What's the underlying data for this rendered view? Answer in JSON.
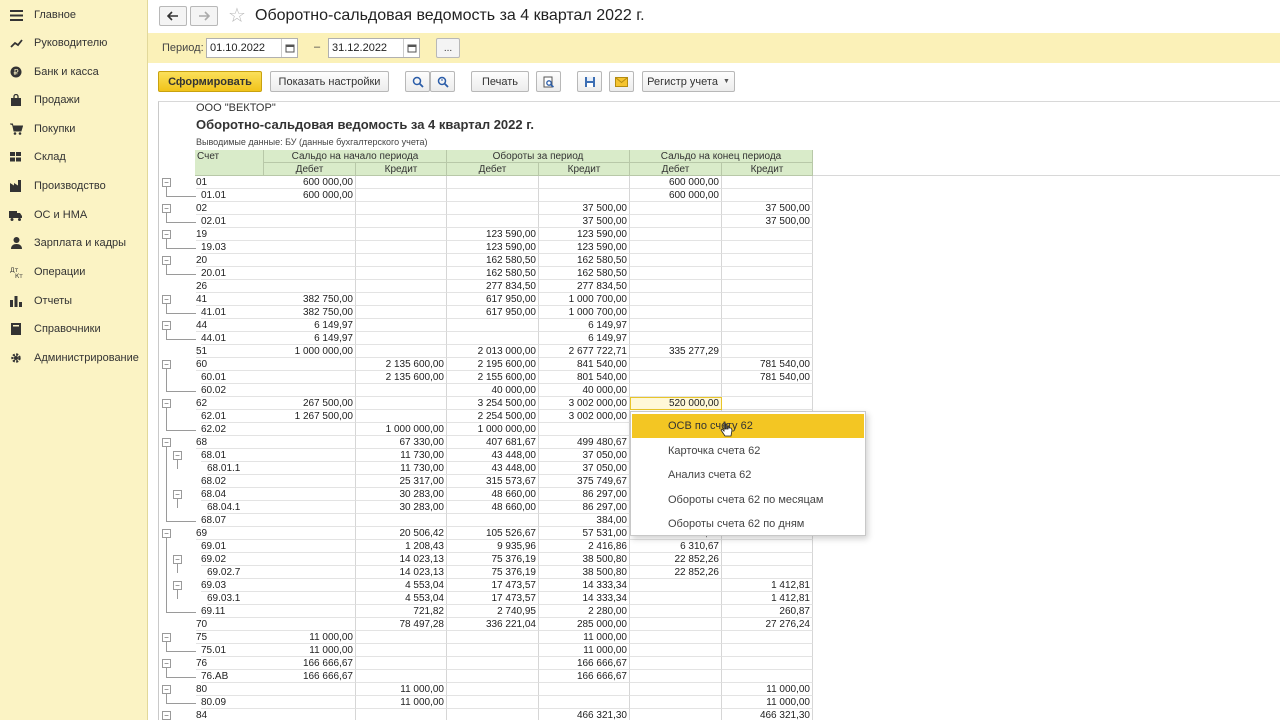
{
  "sidebar": {
    "items": [
      {
        "label": "Главное",
        "icon": "menu-icon"
      },
      {
        "label": "Руководителю",
        "icon": "trend-icon"
      },
      {
        "label": "Банк и касса",
        "icon": "coin-icon"
      },
      {
        "label": "Продажи",
        "icon": "bag-icon"
      },
      {
        "label": "Покупки",
        "icon": "cart-icon"
      },
      {
        "label": "Склад",
        "icon": "warehouse-icon"
      },
      {
        "label": "Производство",
        "icon": "factory-icon"
      },
      {
        "label": "ОС и НМА",
        "icon": "truck-icon"
      },
      {
        "label": "Зарплата и кадры",
        "icon": "person-icon"
      },
      {
        "label": "Операции",
        "icon": "operations-icon"
      },
      {
        "label": "Отчеты",
        "icon": "bar-chart-icon"
      },
      {
        "label": "Справочники",
        "icon": "book-icon"
      },
      {
        "label": "Администрирование",
        "icon": "gear-icon"
      }
    ]
  },
  "header": {
    "title": "Оборотно-сальдовая ведомость за 4 квартал 2022 г."
  },
  "period": {
    "label": "Период:",
    "from": "01.10.2022",
    "to": "31.12.2022",
    "dash": "–",
    "more": "..."
  },
  "toolbar": {
    "generate": "Сформировать",
    "settings": "Показать настройки",
    "print": "Печать",
    "register": "Регистр учета"
  },
  "report": {
    "org": "ООО \"ВЕКТОР\"",
    "title": "Оборотно-сальдовая ведомость за 4 квартал 2022 г.",
    "output": "Выводимые данные:  БУ (данные бухгалтерского учета)",
    "headers": {
      "account": "Счет",
      "opening": "Сальдо на начало периода",
      "turnover": "Обороты за период",
      "closing": "Сальдо на конец периода",
      "debit": "Дебет",
      "credit": "Кредит"
    },
    "rows": [
      {
        "acct": "01",
        "lvl": 0,
        "tog": true,
        "v": [
          "600 000,00",
          "",
          "",
          "",
          "600 000,00",
          ""
        ]
      },
      {
        "acct": "01.01",
        "lvl": 1,
        "tog": false,
        "v": [
          "600 000,00",
          "",
          "",
          "",
          "600 000,00",
          ""
        ]
      },
      {
        "acct": "02",
        "lvl": 0,
        "tog": true,
        "v": [
          "",
          "",
          "",
          "37 500,00",
          "",
          "37 500,00"
        ]
      },
      {
        "acct": "02.01",
        "lvl": 1,
        "tog": false,
        "v": [
          "",
          "",
          "",
          "37 500,00",
          "",
          "37 500,00"
        ]
      },
      {
        "acct": "19",
        "lvl": 0,
        "tog": true,
        "v": [
          "",
          "",
          "123 590,00",
          "123 590,00",
          "",
          ""
        ]
      },
      {
        "acct": "19.03",
        "lvl": 1,
        "tog": false,
        "v": [
          "",
          "",
          "123 590,00",
          "123 590,00",
          "",
          ""
        ]
      },
      {
        "acct": "20",
        "lvl": 0,
        "tog": true,
        "v": [
          "",
          "",
          "162 580,50",
          "162 580,50",
          "",
          ""
        ]
      },
      {
        "acct": "20.01",
        "lvl": 1,
        "tog": false,
        "v": [
          "",
          "",
          "162 580,50",
          "162 580,50",
          "",
          ""
        ]
      },
      {
        "acct": "26",
        "lvl": 0,
        "tog": false,
        "v": [
          "",
          "",
          "277 834,50",
          "277 834,50",
          "",
          ""
        ]
      },
      {
        "acct": "41",
        "lvl": 0,
        "tog": true,
        "v": [
          "382 750,00",
          "",
          "617 950,00",
          "1 000 700,00",
          "",
          ""
        ]
      },
      {
        "acct": "41.01",
        "lvl": 1,
        "tog": false,
        "v": [
          "382 750,00",
          "",
          "617 950,00",
          "1 000 700,00",
          "",
          ""
        ]
      },
      {
        "acct": "44",
        "lvl": 0,
        "tog": true,
        "v": [
          "6 149,97",
          "",
          "",
          "6 149,97",
          "",
          ""
        ]
      },
      {
        "acct": "44.01",
        "lvl": 1,
        "tog": false,
        "v": [
          "6 149,97",
          "",
          "",
          "6 149,97",
          "",
          ""
        ]
      },
      {
        "acct": "51",
        "lvl": 0,
        "tog": false,
        "v": [
          "1 000 000,00",
          "",
          "2 013 000,00",
          "2 677 722,71",
          "335 277,29",
          ""
        ]
      },
      {
        "acct": "60",
        "lvl": 0,
        "tog": true,
        "v": [
          "",
          "2 135 600,00",
          "2 195 600,00",
          "841 540,00",
          "",
          "781 540,00"
        ]
      },
      {
        "acct": "60.01",
        "lvl": 1,
        "tog": false,
        "v": [
          "",
          "2 135 600,00",
          "2 155 600,00",
          "801 540,00",
          "",
          "781 540,00"
        ]
      },
      {
        "acct": "60.02",
        "lvl": 1,
        "tog": false,
        "v": [
          "",
          "",
          "40 000,00",
          "40 000,00",
          "",
          ""
        ]
      },
      {
        "acct": "62",
        "lvl": 0,
        "tog": true,
        "v": [
          "267 500,00",
          "",
          "3 254 500,00",
          "3 002 000,00",
          "520 000,00",
          ""
        ]
      },
      {
        "acct": "62.01",
        "lvl": 1,
        "tog": false,
        "v": [
          "1 267 500,00",
          "",
          "2 254 500,00",
          "3 002 000,00",
          "",
          ""
        ]
      },
      {
        "acct": "62.02",
        "lvl": 1,
        "tog": false,
        "v": [
          "",
          "1 000 000,00",
          "1 000 000,00",
          "",
          "",
          ""
        ]
      },
      {
        "acct": "68",
        "lvl": 0,
        "tog": true,
        "v": [
          "",
          "67 330,00",
          "407 681,67",
          "499 480,67",
          "",
          ""
        ]
      },
      {
        "acct": "68.01",
        "lvl": 1,
        "tog": true,
        "v": [
          "",
          "11 730,00",
          "43 448,00",
          "37 050,00",
          "",
          ""
        ]
      },
      {
        "acct": "68.01.1",
        "lvl": 2,
        "tog": false,
        "v": [
          "",
          "11 730,00",
          "43 448,00",
          "37 050,00",
          "",
          ""
        ]
      },
      {
        "acct": "68.02",
        "lvl": 1,
        "tog": false,
        "v": [
          "",
          "25 317,00",
          "315 573,67",
          "375 749,67",
          "",
          ""
        ]
      },
      {
        "acct": "68.04",
        "lvl": 1,
        "tog": true,
        "v": [
          "",
          "30 283,00",
          "48 660,00",
          "86 297,00",
          "",
          ""
        ]
      },
      {
        "acct": "68.04.1",
        "lvl": 2,
        "tog": false,
        "v": [
          "",
          "30 283,00",
          "48 660,00",
          "86 297,00",
          "",
          ""
        ]
      },
      {
        "acct": "68.07",
        "lvl": 1,
        "tog": false,
        "v": [
          "",
          "",
          "",
          "384,00",
          "",
          ""
        ]
      },
      {
        "acct": "69",
        "lvl": 0,
        "tog": true,
        "v": [
          "",
          "20 506,42",
          "105 526,67",
          "57 531,00",
          "27 489,25",
          ""
        ]
      },
      {
        "acct": "69.01",
        "lvl": 1,
        "tog": false,
        "v": [
          "",
          "1 208,43",
          "9 935,96",
          "2 416,86",
          "6 310,67",
          ""
        ]
      },
      {
        "acct": "69.02",
        "lvl": 1,
        "tog": true,
        "v": [
          "",
          "14 023,13",
          "75 376,19",
          "38 500,80",
          "22 852,26",
          ""
        ]
      },
      {
        "acct": "69.02.7",
        "lvl": 2,
        "tog": false,
        "v": [
          "",
          "14 023,13",
          "75 376,19",
          "38 500,80",
          "22 852,26",
          ""
        ]
      },
      {
        "acct": "69.03",
        "lvl": 1,
        "tog": true,
        "v": [
          "",
          "4 553,04",
          "17 473,57",
          "14 333,34",
          "",
          "1 412,81"
        ]
      },
      {
        "acct": "69.03.1",
        "lvl": 2,
        "tog": false,
        "v": [
          "",
          "4 553,04",
          "17 473,57",
          "14 333,34",
          "",
          "1 412,81"
        ]
      },
      {
        "acct": "69.11",
        "lvl": 1,
        "tog": false,
        "v": [
          "",
          "721,82",
          "2 740,95",
          "2 280,00",
          "",
          "260,87"
        ]
      },
      {
        "acct": "70",
        "lvl": 0,
        "tog": false,
        "v": [
          "",
          "78 497,28",
          "336 221,04",
          "285 000,00",
          "",
          "27 276,24"
        ]
      },
      {
        "acct": "75",
        "lvl": 0,
        "tog": true,
        "v": [
          "11 000,00",
          "",
          "",
          "11 000,00",
          "",
          ""
        ]
      },
      {
        "acct": "75.01",
        "lvl": 1,
        "tog": false,
        "v": [
          "11 000,00",
          "",
          "",
          "11 000,00",
          "",
          ""
        ]
      },
      {
        "acct": "76",
        "lvl": 0,
        "tog": true,
        "v": [
          "166 666,67",
          "",
          "",
          "166 666,67",
          "",
          ""
        ]
      },
      {
        "acct": "76.АВ",
        "lvl": 1,
        "tog": false,
        "v": [
          "166 666,67",
          "",
          "",
          "166 666,67",
          "",
          ""
        ]
      },
      {
        "acct": "80",
        "lvl": 0,
        "tog": true,
        "v": [
          "",
          "11 000,00",
          "",
          "",
          "",
          "11 000,00"
        ]
      },
      {
        "acct": "80.09",
        "lvl": 1,
        "tog": false,
        "v": [
          "",
          "11 000,00",
          "",
          "",
          "",
          "11 000,00"
        ]
      },
      {
        "acct": "84",
        "lvl": 0,
        "tog": true,
        "v": [
          "",
          "",
          "",
          "466 321,30",
          "",
          "466 321,30"
        ]
      }
    ]
  },
  "context_menu": {
    "items": [
      {
        "label": "ОСВ по счету 62",
        "active": true
      },
      {
        "label": "Карточка счета 62",
        "active": false
      },
      {
        "label": "Анализ счета 62",
        "active": false
      },
      {
        "label": "Обороты счета 62 по месяцам",
        "active": false
      },
      {
        "label": "Обороты счета 62 по дням",
        "active": false
      }
    ]
  }
}
